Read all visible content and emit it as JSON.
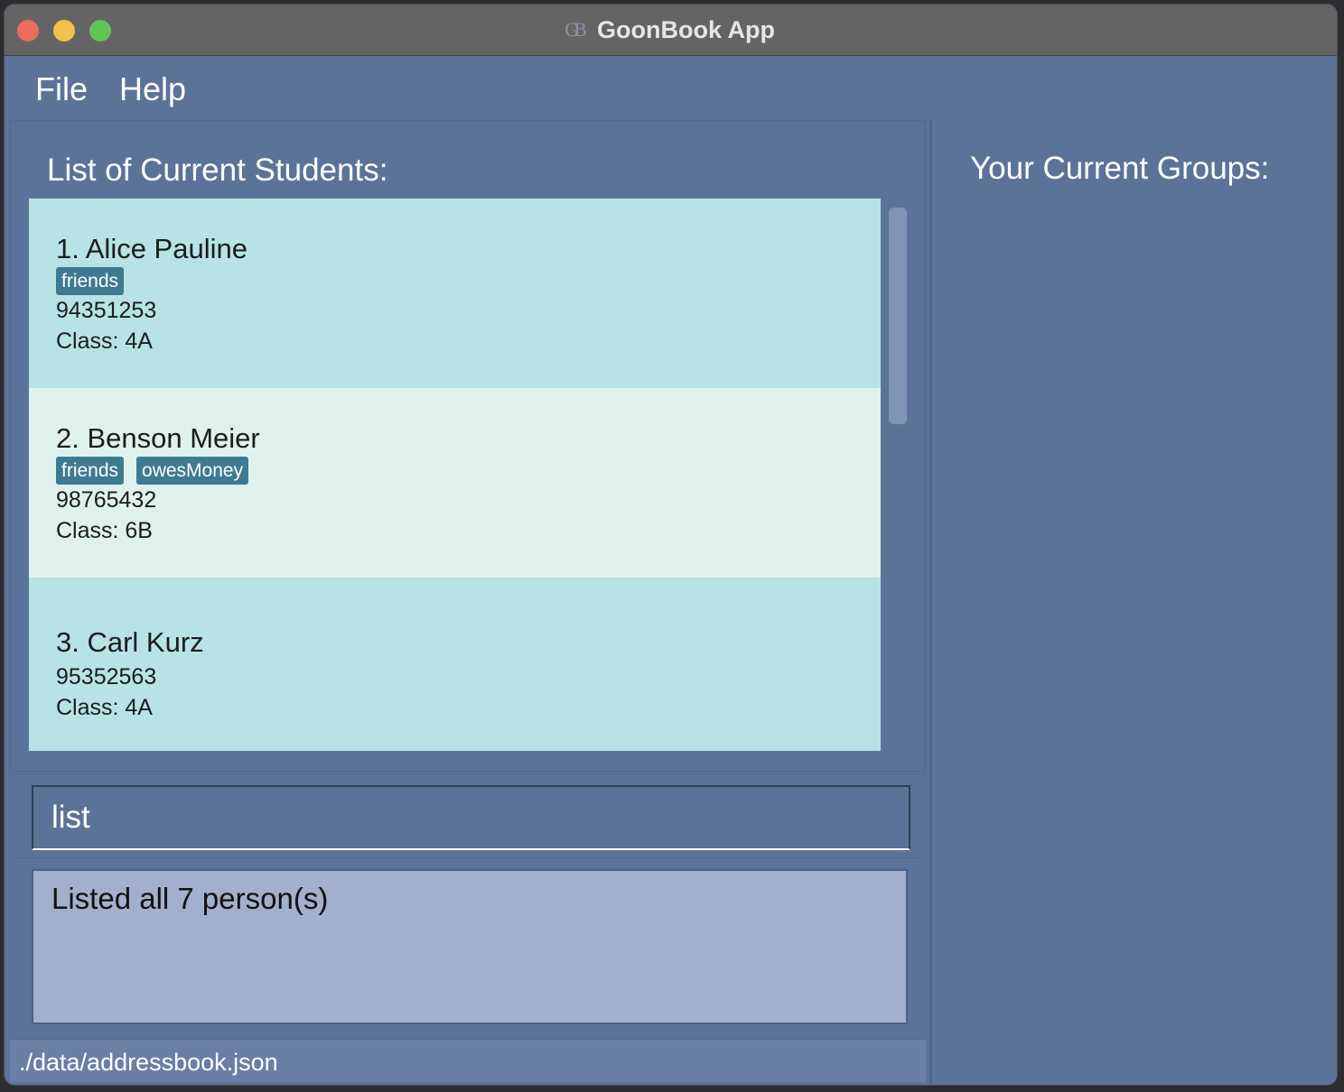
{
  "window": {
    "title": "GoonBook App",
    "app_icon": "goonbook-logo-icon",
    "app_icon_text": "GB"
  },
  "menu": {
    "file": "File",
    "help": "Help"
  },
  "students_panel": {
    "title": "List of Current Students:",
    "students": [
      {
        "name": "1. Alice Pauline",
        "tags": [
          "friends"
        ],
        "phone": "94351253",
        "class": "Class: 4A"
      },
      {
        "name": "2. Benson Meier",
        "tags": [
          "friends",
          "owesMoney"
        ],
        "phone": "98765432",
        "class": "Class: 6B"
      },
      {
        "name": "3. Carl Kurz",
        "tags": [],
        "phone": "95352563",
        "class": "Class: 4A"
      }
    ]
  },
  "command": {
    "value": "list"
  },
  "result": {
    "message": "Listed all 7 person(s)"
  },
  "status_bar": {
    "path": "./data/addressbook.json"
  },
  "groups_panel": {
    "title": "Your Current Groups:"
  },
  "colors": {
    "window_bg": "#5c7399",
    "card_odd": "#b7e3e6",
    "card_even": "#dff1ec",
    "tag_bg": "#3e7b91",
    "result_bg": "#a1b0cc"
  }
}
